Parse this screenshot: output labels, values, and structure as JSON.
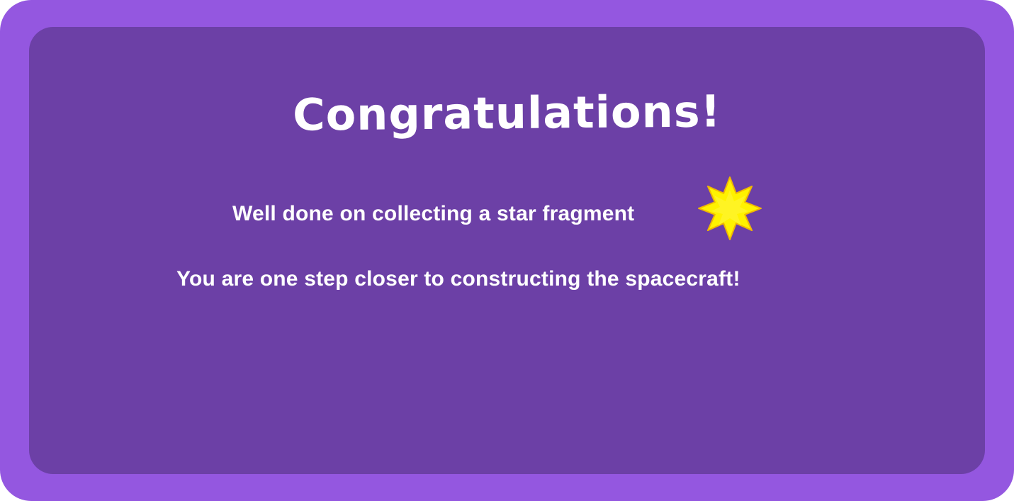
{
  "popup": {
    "title": "Congratulations!",
    "message_line_1": "Well done on collecting a star fragment",
    "message_line_2": "You are one step closer to constructing the spacecraft!",
    "icon": "star-fragment-icon"
  },
  "colors": {
    "frame": "#9457e0",
    "panel": "#6c40a6",
    "text": "#ffffff",
    "star_fill": "#fff200",
    "star_outline": "#f2c200"
  }
}
